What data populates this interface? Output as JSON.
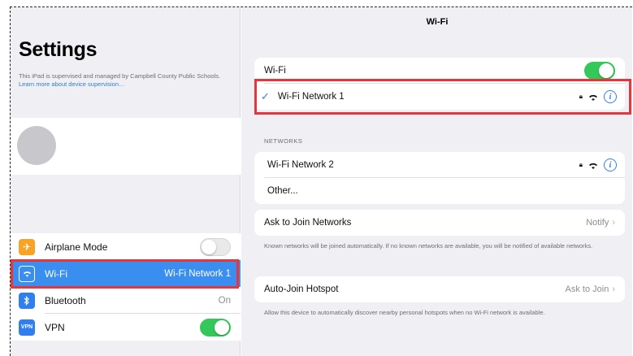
{
  "sidebar": {
    "title": "Settings",
    "supervision_text": "This iPad is supervised and managed by Campbell County Public Schools.",
    "learn_more": "Learn more about device supervision…",
    "items": [
      {
        "label": "Airplane Mode",
        "icon": "airplane-icon",
        "toggle": "off"
      },
      {
        "label": "Wi-Fi",
        "value": "Wi-Fi Network 1",
        "icon": "wifi-icon",
        "selected": true
      },
      {
        "label": "Bluetooth",
        "value": "On",
        "icon": "bluetooth-icon"
      },
      {
        "label": "VPN",
        "icon": "vpn-icon",
        "icon_text": "VPN",
        "toggle": "on"
      }
    ]
  },
  "detail": {
    "title": "Wi-Fi",
    "wifi_label": "Wi-Fi",
    "wifi_toggle": "on",
    "connected_network": "Wi-Fi Network 1",
    "networks_header": "NETWORKS",
    "networks": [
      {
        "name": "Wi-Fi Network 2",
        "secured": true
      }
    ],
    "other_label": "Other...",
    "ask_to_join": {
      "label": "Ask to Join Networks",
      "value": "Notify"
    },
    "ask_to_join_note": "Known networks will be joined automatically. If no known networks are available, you will be notified of available networks.",
    "auto_join": {
      "label": "Auto-Join Hotspot",
      "value": "Ask to Join"
    },
    "auto_join_note": "Allow this device to automatically discover nearby personal hotspots when no Wi-Fi network is available."
  },
  "colors": {
    "accent": "#3a8ef0",
    "highlight": "#e8343d",
    "toggle_on": "#34c759"
  }
}
